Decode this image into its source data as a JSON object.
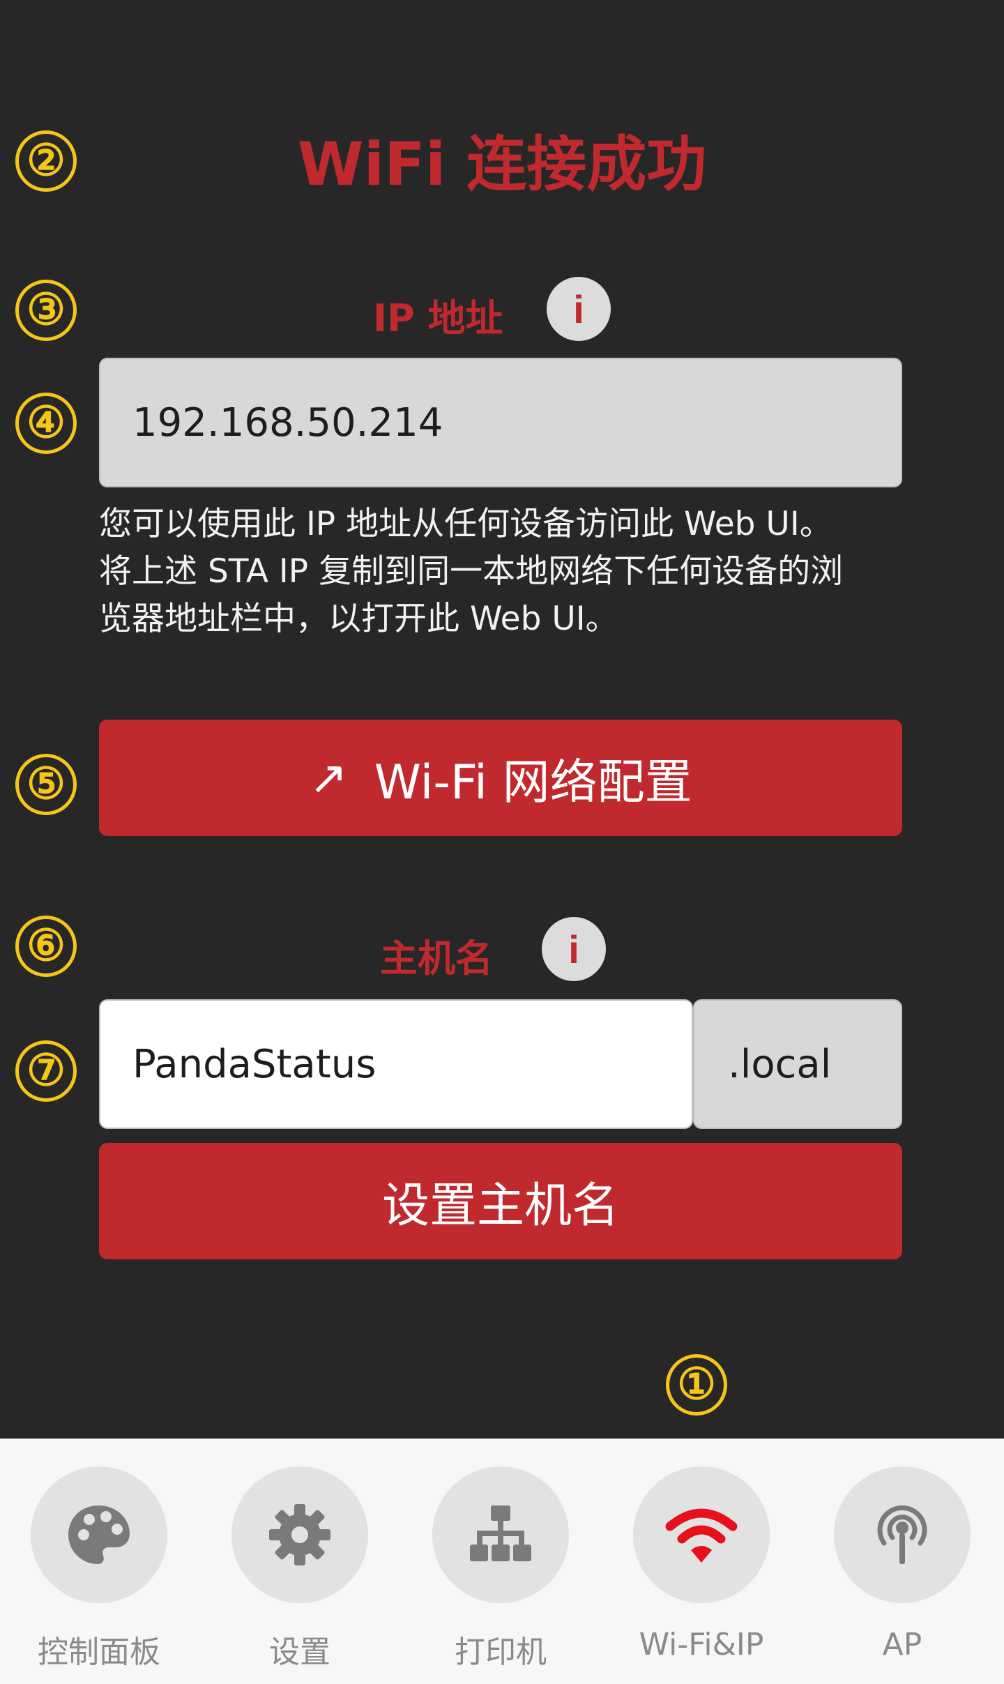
{
  "markers": [
    "②",
    "③",
    "④",
    "⑤",
    "⑥",
    "⑦",
    "①"
  ],
  "page": {
    "title": "WiFi 连接成功"
  },
  "ip_section": {
    "label": "IP 地址",
    "info_glyph": "i",
    "value": "192.168.50.214",
    "hint_lines": [
      "您可以使用此 IP 地址从任何设备访问此 Web UI。",
      "将上述 STA IP 复制到同一本地网络下任何设备的浏",
      "览器地址栏中，以打开此 Web UI。"
    ]
  },
  "wifi_button": {
    "arrow": "↗",
    "label": "Wi-Fi 网络配置"
  },
  "hostname_section": {
    "label": "主机名",
    "info_glyph": "i",
    "value": "PandaStatus",
    "suffix": ".local",
    "set_button_label": "设置主机名"
  },
  "nav": {
    "items": [
      {
        "label": "控制面板",
        "icon": "palette-icon",
        "active": false
      },
      {
        "label": "设置",
        "icon": "gear-icon",
        "active": false
      },
      {
        "label": "打印机",
        "icon": "network-tree-icon",
        "active": false
      },
      {
        "label": "Wi-Fi&IP",
        "icon": "wifi-icon",
        "active": true
      },
      {
        "label": "AP",
        "icon": "broadcast-tower-icon",
        "active": false
      }
    ]
  },
  "colors": {
    "background": "#282728",
    "accent_red": "#c0292e",
    "marker_yellow": "#f5c518",
    "active_icon": "#e5121c",
    "inactive_icon": "#7a7a7a"
  }
}
